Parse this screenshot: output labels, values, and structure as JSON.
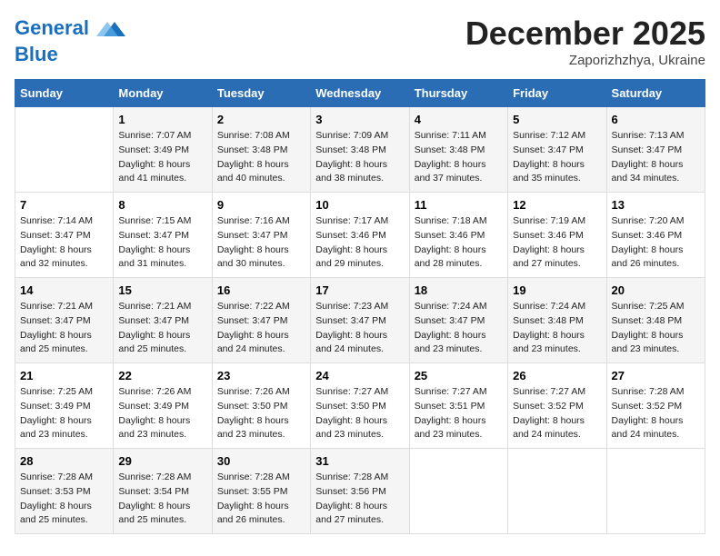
{
  "header": {
    "logo_line1": "General",
    "logo_line2": "Blue",
    "month": "December 2025",
    "location": "Zaporizhzhya, Ukraine"
  },
  "days_of_week": [
    "Sunday",
    "Monday",
    "Tuesday",
    "Wednesday",
    "Thursday",
    "Friday",
    "Saturday"
  ],
  "weeks": [
    [
      {
        "day": "",
        "sunrise": "",
        "sunset": "",
        "daylight": ""
      },
      {
        "day": "1",
        "sunrise": "Sunrise: 7:07 AM",
        "sunset": "Sunset: 3:49 PM",
        "daylight": "Daylight: 8 hours and 41 minutes."
      },
      {
        "day": "2",
        "sunrise": "Sunrise: 7:08 AM",
        "sunset": "Sunset: 3:48 PM",
        "daylight": "Daylight: 8 hours and 40 minutes."
      },
      {
        "day": "3",
        "sunrise": "Sunrise: 7:09 AM",
        "sunset": "Sunset: 3:48 PM",
        "daylight": "Daylight: 8 hours and 38 minutes."
      },
      {
        "day": "4",
        "sunrise": "Sunrise: 7:11 AM",
        "sunset": "Sunset: 3:48 PM",
        "daylight": "Daylight: 8 hours and 37 minutes."
      },
      {
        "day": "5",
        "sunrise": "Sunrise: 7:12 AM",
        "sunset": "Sunset: 3:47 PM",
        "daylight": "Daylight: 8 hours and 35 minutes."
      },
      {
        "day": "6",
        "sunrise": "Sunrise: 7:13 AM",
        "sunset": "Sunset: 3:47 PM",
        "daylight": "Daylight: 8 hours and 34 minutes."
      }
    ],
    [
      {
        "day": "7",
        "sunrise": "Sunrise: 7:14 AM",
        "sunset": "Sunset: 3:47 PM",
        "daylight": "Daylight: 8 hours and 32 minutes."
      },
      {
        "day": "8",
        "sunrise": "Sunrise: 7:15 AM",
        "sunset": "Sunset: 3:47 PM",
        "daylight": "Daylight: 8 hours and 31 minutes."
      },
      {
        "day": "9",
        "sunrise": "Sunrise: 7:16 AM",
        "sunset": "Sunset: 3:47 PM",
        "daylight": "Daylight: 8 hours and 30 minutes."
      },
      {
        "day": "10",
        "sunrise": "Sunrise: 7:17 AM",
        "sunset": "Sunset: 3:46 PM",
        "daylight": "Daylight: 8 hours and 29 minutes."
      },
      {
        "day": "11",
        "sunrise": "Sunrise: 7:18 AM",
        "sunset": "Sunset: 3:46 PM",
        "daylight": "Daylight: 8 hours and 28 minutes."
      },
      {
        "day": "12",
        "sunrise": "Sunrise: 7:19 AM",
        "sunset": "Sunset: 3:46 PM",
        "daylight": "Daylight: 8 hours and 27 minutes."
      },
      {
        "day": "13",
        "sunrise": "Sunrise: 7:20 AM",
        "sunset": "Sunset: 3:46 PM",
        "daylight": "Daylight: 8 hours and 26 minutes."
      }
    ],
    [
      {
        "day": "14",
        "sunrise": "Sunrise: 7:21 AM",
        "sunset": "Sunset: 3:47 PM",
        "daylight": "Daylight: 8 hours and 25 minutes."
      },
      {
        "day": "15",
        "sunrise": "Sunrise: 7:21 AM",
        "sunset": "Sunset: 3:47 PM",
        "daylight": "Daylight: 8 hours and 25 minutes."
      },
      {
        "day": "16",
        "sunrise": "Sunrise: 7:22 AM",
        "sunset": "Sunset: 3:47 PM",
        "daylight": "Daylight: 8 hours and 24 minutes."
      },
      {
        "day": "17",
        "sunrise": "Sunrise: 7:23 AM",
        "sunset": "Sunset: 3:47 PM",
        "daylight": "Daylight: 8 hours and 24 minutes."
      },
      {
        "day": "18",
        "sunrise": "Sunrise: 7:24 AM",
        "sunset": "Sunset: 3:47 PM",
        "daylight": "Daylight: 8 hours and 23 minutes."
      },
      {
        "day": "19",
        "sunrise": "Sunrise: 7:24 AM",
        "sunset": "Sunset: 3:48 PM",
        "daylight": "Daylight: 8 hours and 23 minutes."
      },
      {
        "day": "20",
        "sunrise": "Sunrise: 7:25 AM",
        "sunset": "Sunset: 3:48 PM",
        "daylight": "Daylight: 8 hours and 23 minutes."
      }
    ],
    [
      {
        "day": "21",
        "sunrise": "Sunrise: 7:25 AM",
        "sunset": "Sunset: 3:49 PM",
        "daylight": "Daylight: 8 hours and 23 minutes."
      },
      {
        "day": "22",
        "sunrise": "Sunrise: 7:26 AM",
        "sunset": "Sunset: 3:49 PM",
        "daylight": "Daylight: 8 hours and 23 minutes."
      },
      {
        "day": "23",
        "sunrise": "Sunrise: 7:26 AM",
        "sunset": "Sunset: 3:50 PM",
        "daylight": "Daylight: 8 hours and 23 minutes."
      },
      {
        "day": "24",
        "sunrise": "Sunrise: 7:27 AM",
        "sunset": "Sunset: 3:50 PM",
        "daylight": "Daylight: 8 hours and 23 minutes."
      },
      {
        "day": "25",
        "sunrise": "Sunrise: 7:27 AM",
        "sunset": "Sunset: 3:51 PM",
        "daylight": "Daylight: 8 hours and 23 minutes."
      },
      {
        "day": "26",
        "sunrise": "Sunrise: 7:27 AM",
        "sunset": "Sunset: 3:52 PM",
        "daylight": "Daylight: 8 hours and 24 minutes."
      },
      {
        "day": "27",
        "sunrise": "Sunrise: 7:28 AM",
        "sunset": "Sunset: 3:52 PM",
        "daylight": "Daylight: 8 hours and 24 minutes."
      }
    ],
    [
      {
        "day": "28",
        "sunrise": "Sunrise: 7:28 AM",
        "sunset": "Sunset: 3:53 PM",
        "daylight": "Daylight: 8 hours and 25 minutes."
      },
      {
        "day": "29",
        "sunrise": "Sunrise: 7:28 AM",
        "sunset": "Sunset: 3:54 PM",
        "daylight": "Daylight: 8 hours and 25 minutes."
      },
      {
        "day": "30",
        "sunrise": "Sunrise: 7:28 AM",
        "sunset": "Sunset: 3:55 PM",
        "daylight": "Daylight: 8 hours and 26 minutes."
      },
      {
        "day": "31",
        "sunrise": "Sunrise: 7:28 AM",
        "sunset": "Sunset: 3:56 PM",
        "daylight": "Daylight: 8 hours and 27 minutes."
      },
      {
        "day": "",
        "sunrise": "",
        "sunset": "",
        "daylight": ""
      },
      {
        "day": "",
        "sunrise": "",
        "sunset": "",
        "daylight": ""
      },
      {
        "day": "",
        "sunrise": "",
        "sunset": "",
        "daylight": ""
      }
    ]
  ]
}
